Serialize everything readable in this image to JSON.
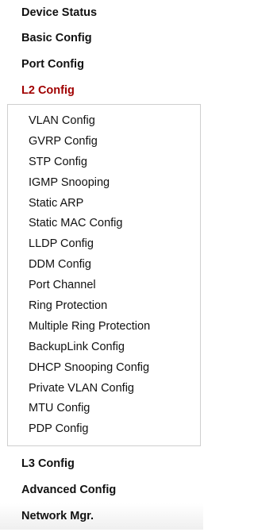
{
  "menu": {
    "top_before": [
      {
        "label": "Device Status"
      },
      {
        "label": "Basic Config"
      },
      {
        "label": "Port Config"
      }
    ],
    "active": {
      "label": "L2 Config",
      "color": "#a00000"
    },
    "submenu": [
      "VLAN Config",
      "GVRP Config",
      "STP Config",
      "IGMP Snooping",
      "Static ARP",
      "Static MAC Config",
      "LLDP Config",
      "DDM Config",
      "Port Channel",
      "Ring Protection",
      "Multiple Ring Protection",
      "BackupLink Config",
      "DHCP Snooping Config",
      "Private VLAN Config",
      "MTU Config",
      "PDP Config"
    ],
    "top_after": [
      {
        "label": "L3 Config"
      },
      {
        "label": "Advanced Config"
      },
      {
        "label": "Network Mgr."
      }
    ]
  }
}
